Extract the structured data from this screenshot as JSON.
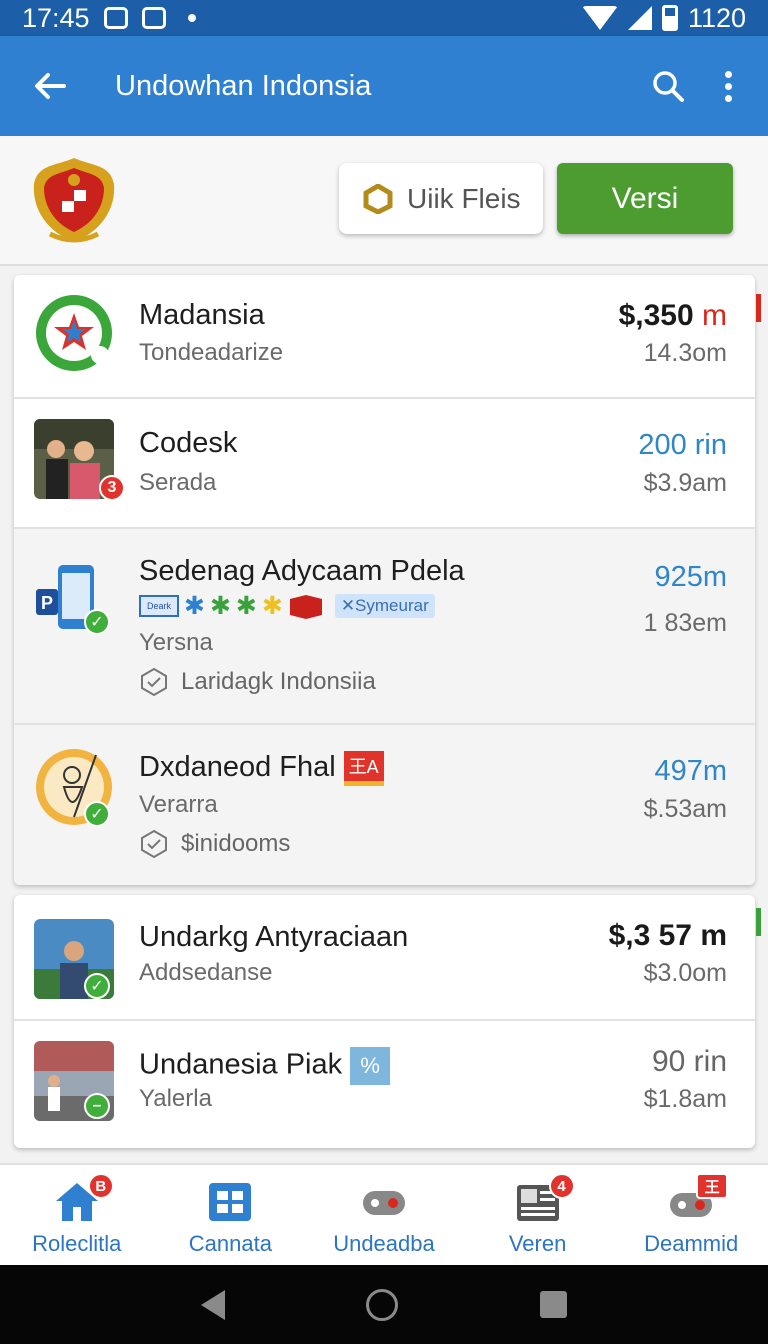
{
  "status_bar": {
    "time": "17:45",
    "battery_text": "1120"
  },
  "app_bar": {
    "title": "Undowhan Indonsia"
  },
  "header": {
    "chip_label": "Uiik Fleis",
    "primary_button": "Versi"
  },
  "list_card_1": {
    "rows": [
      {
        "title": "Madansia",
        "subtitle": "Tondeadarize",
        "price_main": "$,350",
        "price_suffix": " m",
        "sub_price": "14.3om"
      },
      {
        "title": "Codesk",
        "subtitle": "Serada",
        "price": "200 rin",
        "sub_price": "$3.9am",
        "badge": "3"
      },
      {
        "title": "Sedenag Adycaam Pdela",
        "doc_tag": "Deark",
        "chip": "✕Symeurar",
        "subtitle": "Yersna",
        "tag": "Laridagk Indonsiia",
        "price": "925m",
        "sub_price": "1 83em"
      },
      {
        "title": "Dxdaneod Fhal",
        "title_chip": "王A",
        "subtitle": "Verarra",
        "tag": "$inidooms",
        "price": "497m",
        "sub_price": "$.53am"
      }
    ]
  },
  "list_card_2": {
    "rows": [
      {
        "title": "Undarkg Antyraciaan",
        "subtitle": "Addsedanse",
        "price": "$,3 57 m",
        "sub_price": "$3.0om"
      },
      {
        "title": "Undanesia Piak",
        "title_chip": "%",
        "subtitle": "Yalerla",
        "price": "90 rin",
        "sub_price": "$1.8am"
      }
    ]
  },
  "bottom_nav": [
    {
      "label": "Roleclitla",
      "icon": "home-icon",
      "badge": "B"
    },
    {
      "label": "Cannata",
      "icon": "grid-icon"
    },
    {
      "label": "Undeadba",
      "icon": "gamepad-icon"
    },
    {
      "label": "Veren",
      "icon": "news-icon",
      "badge": "4"
    },
    {
      "label": "Deammid",
      "icon": "controller-icon",
      "badge": "王"
    }
  ],
  "colors": {
    "app_bar": "#2f80d1",
    "status_bar": "#1c5ea8",
    "primary_green": "#4c9c30",
    "link_blue": "#2f86c8",
    "badge_red": "#e2322d"
  }
}
